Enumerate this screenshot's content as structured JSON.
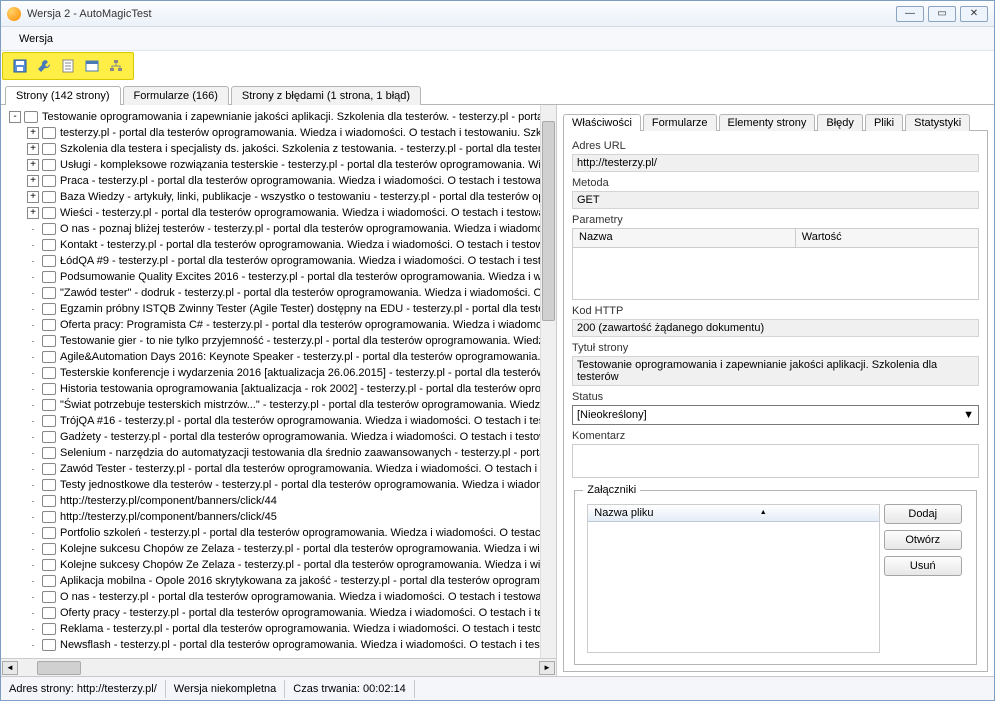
{
  "window": {
    "title": "Wersja 2 - AutoMagicTest"
  },
  "menu": {
    "wersja": "Wersja"
  },
  "maintabs": [
    {
      "label": "Strony (142 strony)"
    },
    {
      "label": "Formularze (166)"
    },
    {
      "label": "Strony z błędami (1 strona, 1 błąd)"
    }
  ],
  "tree": {
    "root": {
      "label": "Testowanie oprogramowania i zapewnianie jakości aplikacji. Szkolenia dla testerów. - testerzy.pl - portal"
    },
    "children": [
      {
        "exp": "+",
        "label": "testerzy.pl - portal dla testerów oprogramowania. Wiedza i wiadomości. O testach i testowaniu. Szkc"
      },
      {
        "exp": "+",
        "label": "Szkolenia dla testera i specjalisty ds. jakości. Szkolenia z testowania. - testerzy.pl - portal dla tester"
      },
      {
        "exp": "+",
        "label": "Usługi - kompleksowe rozwiązania testerskie - testerzy.pl - portal dla testerów oprogramowania. Wie"
      },
      {
        "exp": "+",
        "label": "Praca - testerzy.pl - portal dla testerów oprogramowania. Wiedza i wiadomości. O testach i testowan"
      },
      {
        "exp": "+",
        "label": "Baza Wiedzy - artykuły, linki, publikacje - wszystko o testowaniu - testerzy.pl - portal dla testerów op"
      },
      {
        "exp": "+",
        "label": "Wieści - testerzy.pl - portal dla testerów oprogramowania. Wiedza i wiadomości. O testach i testowar"
      },
      {
        "exp": "",
        "label": "O nas - poznaj bliżej testerów - testerzy.pl - portal dla testerów oprogramowania. Wiedza i wiadomoś"
      },
      {
        "exp": "",
        "label": "Kontakt - testerzy.pl - portal dla testerów oprogramowania. Wiedza i wiadomości. O testach i testowa"
      },
      {
        "exp": "",
        "label": "ŁódQA #9 - testerzy.pl - portal dla testerów oprogramowania. Wiedza i wiadomości. O testach i testo"
      },
      {
        "exp": "",
        "label": "Podsumowanie Quality Excites 2016 - testerzy.pl - portal dla testerów oprogramowania. Wiedza i wia"
      },
      {
        "exp": "",
        "label": "\"Zawód tester\" - dodruk - testerzy.pl - portal dla testerów oprogramowania. Wiedza i wiadomości. O"
      },
      {
        "exp": "",
        "label": "Egzamin próbny ISTQB Zwinny Tester (Agile Tester) dostępny na EDU - testerzy.pl - portal dla teste"
      },
      {
        "exp": "",
        "label": "Oferta pracy: Programista C# - testerzy.pl - portal dla testerów oprogramowania. Wiedza i wiadomoś"
      },
      {
        "exp": "",
        "label": "Testowanie gier - to nie tylko przyjemność - testerzy.pl - portal dla testerów oprogramowania. Wiedza"
      },
      {
        "exp": "",
        "label": "Agile&Automation Days 2016: Keynote Speaker - testerzy.pl - portal dla testerów oprogramowania. W"
      },
      {
        "exp": "",
        "label": "Testerskie konferencje i wydarzenia 2016 [aktualizacja 26.06.2015] - testerzy.pl - portal dla testerów"
      },
      {
        "exp": "",
        "label": "Historia testowania oprogramowania [aktualizacja - rok 2002] - testerzy.pl - portal dla testerów oprog"
      },
      {
        "exp": "",
        "label": "\"Świat potrzebuje testerskich mistrzów...\" - testerzy.pl - portal dla testerów oprogramowania. Wiedza"
      },
      {
        "exp": "",
        "label": "TrójQA #16 - testerzy.pl - portal dla testerów oprogramowania. Wiedza i wiadomości. O testach i test"
      },
      {
        "exp": "",
        "label": "Gadżety - testerzy.pl - portal dla testerów oprogramowania. Wiedza i wiadomości. O testach i testow"
      },
      {
        "exp": "",
        "label": "Selenium - narzędzia do automatyzacji testowania dla średnio zaawansowanych - testerzy.pl - portal"
      },
      {
        "exp": "",
        "label": "Zawód Tester - testerzy.pl - portal dla testerów oprogramowania. Wiedza i wiadomości. O testach i t"
      },
      {
        "exp": "",
        "label": "Testy jednostkowe dla testerów - testerzy.pl - portal dla testerów oprogramowania. Wiedza i wiadom"
      },
      {
        "exp": "",
        "label": "http://testerzy.pl/component/banners/click/44"
      },
      {
        "exp": "",
        "label": "http://testerzy.pl/component/banners/click/45"
      },
      {
        "exp": "",
        "label": "Portfolio szkoleń - testerzy.pl - portal dla testerów oprogramowania. Wiedza i wiadomości. O testach"
      },
      {
        "exp": "",
        "label": "Kolejne sukcesu Chopów ze Zelaza - testerzy.pl - portal dla testerów oprogramowania. Wiedza i wia"
      },
      {
        "exp": "",
        "label": "Kolejne sukcesy Chopów Ze Zelaza - testerzy.pl - portal dla testerów oprogramowania. Wiedza i wia"
      },
      {
        "exp": "",
        "label": "Aplikacja mobilna - Opole 2016 skrytykowana za jakość - testerzy.pl - portal dla testerów oprogramov"
      },
      {
        "exp": "",
        "label": "O nas - testerzy.pl - portal dla testerów oprogramowania. Wiedza i wiadomości. O testach i testowan"
      },
      {
        "exp": "",
        "label": "Oferty pracy - testerzy.pl - portal dla testerów oprogramowania. Wiedza i wiadomości. O testach i tes"
      },
      {
        "exp": "",
        "label": "Reklama - testerzy.pl - portal dla testerów oprogramowania. Wiedza i wiadomości. O testach i testow"
      },
      {
        "exp": "",
        "label": "Newsflash - testerzy.pl - portal dla testerów oprogramowania. Wiedza i wiadomości. O testach i testo"
      }
    ]
  },
  "proptabs": [
    {
      "label": "Właściwości"
    },
    {
      "label": "Formularze"
    },
    {
      "label": "Elementy strony"
    },
    {
      "label": "Błędy"
    },
    {
      "label": "Pliki"
    },
    {
      "label": "Statystyki"
    }
  ],
  "props": {
    "url_label": "Adres URL",
    "url": "http://testerzy.pl/",
    "method_label": "Metoda",
    "method": "GET",
    "params_label": "Parametry",
    "param_name": "Nazwa",
    "param_value": "Wartość",
    "http_label": "Kod HTTP",
    "http": "200 (zawartość żądanego dokumentu)",
    "title_label": "Tytuł strony",
    "title": "Testowanie oprogramowania i zapewnianie jakości aplikacji. Szkolenia dla testerów",
    "status_label": "Status",
    "status": "[Nieokreślony]",
    "comment_label": "Komentarz",
    "attach_label": "Załączniki",
    "attach_col": "Nazwa pliku",
    "btn_add": "Dodaj",
    "btn_open": "Otwórz",
    "btn_del": "Usuń"
  },
  "status": {
    "addr_label": "Adres strony:",
    "addr": "http://testerzy.pl/",
    "version": "Wersja niekompletna",
    "dur_label": "Czas trwania:",
    "dur": "00:02:14"
  }
}
